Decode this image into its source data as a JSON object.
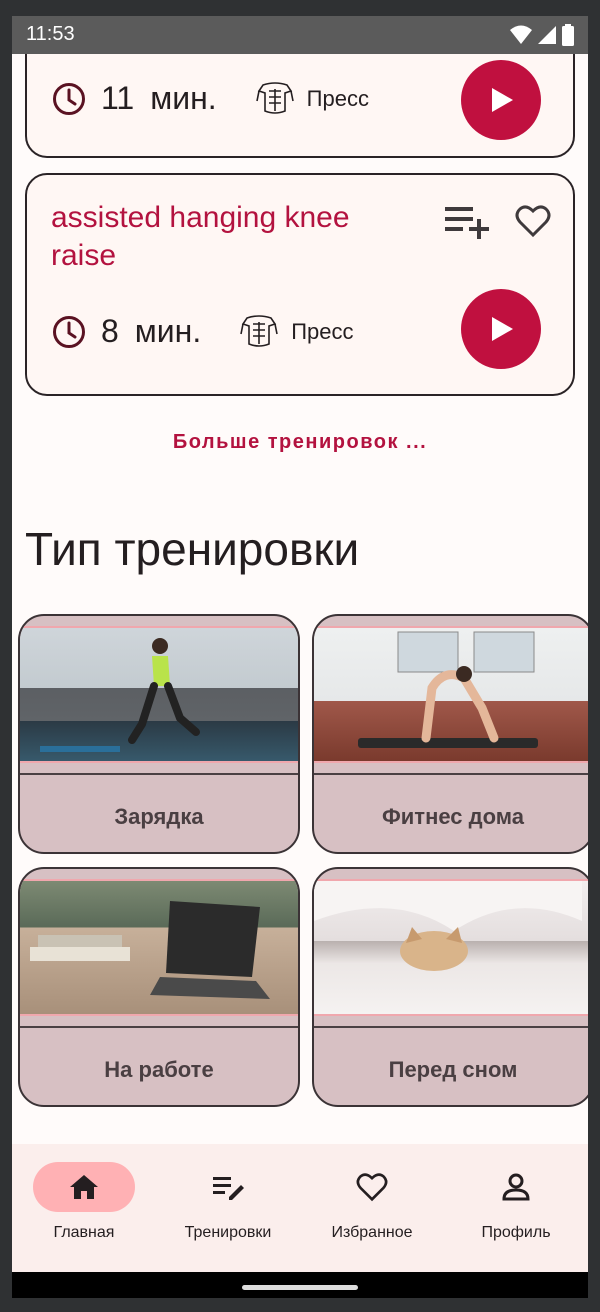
{
  "status_bar": {
    "time": "11:53"
  },
  "workouts": [
    {
      "title": "",
      "minutes": "11",
      "unit": "мин.",
      "muscle": "Пресс"
    },
    {
      "title": "assisted hanging knee raise",
      "minutes": "8",
      "unit": "мин.",
      "muscle": "Пресс"
    }
  ],
  "more_link": "Больше тренировок ...",
  "section_title": "Тип тренировки",
  "workout_types": [
    {
      "label": "Зарядка",
      "icon": "running-photo"
    },
    {
      "label": "Фитнес дома",
      "icon": "yoga-photo"
    },
    {
      "label": "На работе",
      "icon": "laptop-desk-photo"
    },
    {
      "label": "Перед сном",
      "icon": "sleeping-cat-photo"
    }
  ],
  "bottom_nav": {
    "items": [
      {
        "label": "Главная",
        "icon": "home-icon",
        "active": true
      },
      {
        "label": "Тренировки",
        "icon": "list-edit-icon",
        "active": false
      },
      {
        "label": "Избранное",
        "icon": "heart-icon",
        "active": false
      },
      {
        "label": "Профиль",
        "icon": "person-icon",
        "active": false
      }
    ]
  },
  "colors": {
    "accent": "#c0103f",
    "title": "#b3123f",
    "nav_active": "#ffb1b4",
    "card_bg": "#fff7f4",
    "type_card_bg": "#d7c0c3"
  }
}
